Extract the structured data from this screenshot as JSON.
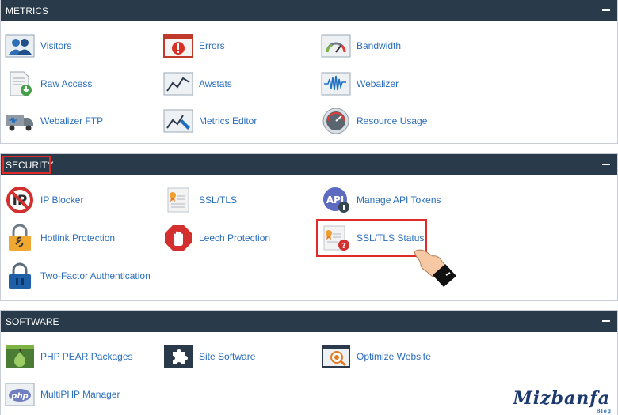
{
  "metrics": {
    "title": "METRICS",
    "items": [
      {
        "label": "Visitors"
      },
      {
        "label": "Errors"
      },
      {
        "label": "Bandwidth"
      },
      {
        "label": "Raw Access"
      },
      {
        "label": "Awstats"
      },
      {
        "label": "Webalizer"
      },
      {
        "label": "Webalizer FTP"
      },
      {
        "label": "Metrics Editor"
      },
      {
        "label": "Resource Usage"
      }
    ]
  },
  "security": {
    "title": "SECURITY",
    "items": [
      {
        "label": "IP Blocker"
      },
      {
        "label": "SSL/TLS"
      },
      {
        "label": "Manage API Tokens"
      },
      {
        "label": "Hotlink Protection"
      },
      {
        "label": "Leech Protection"
      },
      {
        "label": "SSL/TLS Status"
      },
      {
        "label": "Two-Factor Authentication"
      }
    ]
  },
  "software": {
    "title": "SOFTWARE",
    "items": [
      {
        "label": "PHP PEAR Packages"
      },
      {
        "label": "Site Software"
      },
      {
        "label": "Optimize Website"
      },
      {
        "label": "MultiPHP Manager"
      }
    ]
  },
  "icon_text": {
    "api": "API",
    "php": "php"
  },
  "watermark": {
    "brand": "Mizbanfa",
    "sub": "Blog"
  },
  "colors": {
    "header_bg": "#293a4a",
    "link": "#2a6ebb",
    "highlight": "#e02b2b"
  }
}
